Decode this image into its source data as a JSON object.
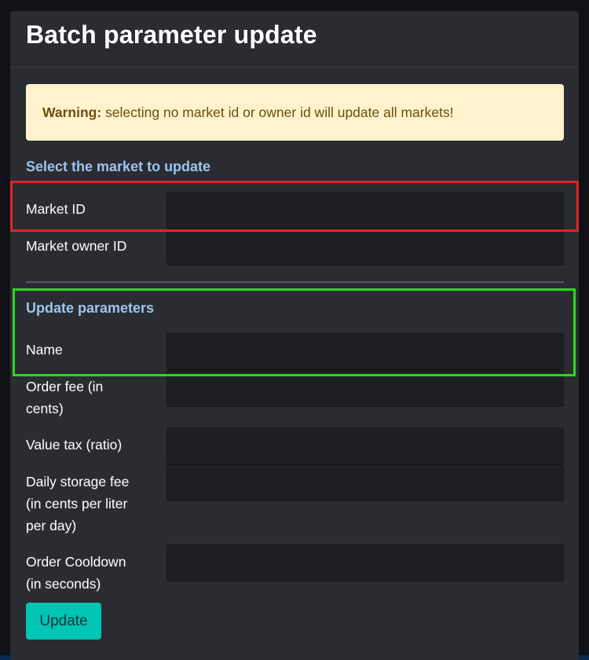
{
  "panel": {
    "title": "Batch parameter update"
  },
  "warning": {
    "strong": "Warning:",
    "text": " selecting no market id or owner id will update all markets!"
  },
  "select_section": {
    "title": "Select the market to update",
    "fields": [
      {
        "label": "Market ID",
        "value": ""
      },
      {
        "label": "Market owner ID",
        "value": ""
      }
    ]
  },
  "update_section": {
    "title": "Update parameters",
    "fields": [
      {
        "label": "Name",
        "value": ""
      },
      {
        "label": "Order fee (in cents)",
        "value": ""
      },
      {
        "label": "Value tax (ratio)",
        "value": ""
      },
      {
        "label": "Daily storage fee (in cents per liter per day)",
        "value": ""
      },
      {
        "label": "Order Cooldown (in seconds)",
        "value": ""
      }
    ]
  },
  "actions": {
    "update_label": "Update"
  },
  "colors": {
    "panel_bg": "#2b2c32",
    "warning_bg": "#fff2cc",
    "section_title": "#9cc4ef",
    "accent": "#00c4b4",
    "highlight_red": "#e0252a",
    "highlight_green": "#2bd81c"
  }
}
